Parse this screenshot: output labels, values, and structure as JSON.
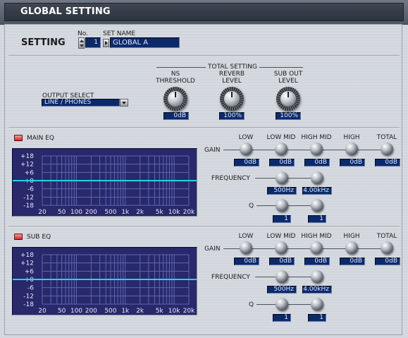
{
  "window": {
    "title": "GLOBAL SETTING"
  },
  "setting": {
    "label": "SETTING",
    "no_label": "No.",
    "no_value": "1",
    "name_label": "SET NAME",
    "name_value": "GLOBAL A"
  },
  "total_setting": {
    "title": "TOTAL SETTING",
    "output_select_label": "OUTPUT SELECT",
    "output_select_value": "LINE / PHONES",
    "ns_threshold": {
      "label1": "NS",
      "label2": "THRESHOLD",
      "value": "0dB"
    },
    "reverb_level": {
      "label1": "REVERB",
      "label2": "LEVEL",
      "value": "100%"
    },
    "sub_out_level": {
      "label1": "SUB OUT",
      "label2": "LEVEL",
      "value": "100%"
    }
  },
  "graph_labels": {
    "y": [
      "+18",
      "+12",
      "+6",
      "+0",
      "-6",
      "-12",
      "-18"
    ],
    "x": [
      "20",
      "50",
      "100",
      "200",
      "500",
      "1k",
      "2k",
      "5k",
      "10k",
      "20k"
    ]
  },
  "main_eq": {
    "title": "MAIN EQ",
    "gain_label": "GAIN",
    "frequency_label": "FREQUENCY",
    "q_label": "Q",
    "bands": [
      "LOW",
      "LOW MID",
      "HIGH MID",
      "HIGH",
      "TOTAL"
    ],
    "gain_values": [
      "0dB",
      "0dB",
      "0dB",
      "0dB",
      "0dB"
    ],
    "freq_values": [
      "500Hz",
      "4.00kHz"
    ],
    "q_values": [
      "1",
      "1"
    ]
  },
  "sub_eq": {
    "title": "SUB EQ",
    "gain_label": "GAIN",
    "frequency_label": "FREQUENCY",
    "q_label": "Q",
    "bands": [
      "LOW",
      "LOW MID",
      "HIGH MID",
      "HIGH",
      "TOTAL"
    ],
    "gain_values": [
      "0dB",
      "0dB",
      "0dB",
      "0dB",
      "0dB"
    ],
    "freq_values": [
      "500Hz",
      "4.00kHz"
    ],
    "q_values": [
      "1",
      "1"
    ]
  },
  "colors": {
    "lcd_bg": "#0c2a6a",
    "graph_bg": "#28286a",
    "curve": "#23d3e8",
    "led": "#e03a3a"
  }
}
